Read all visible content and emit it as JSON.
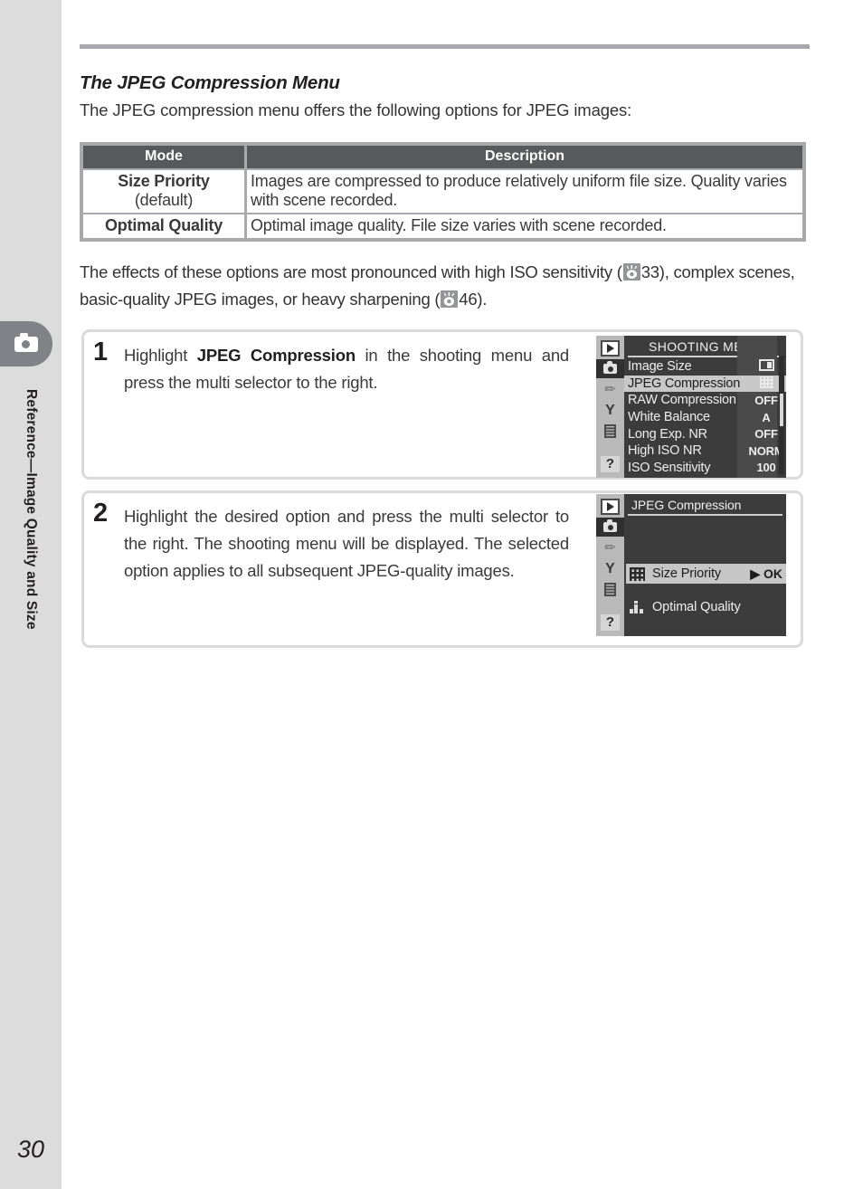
{
  "sidebar": {
    "tab_icon": "camera-icon",
    "chapter_title": "Reference—Image Quality and Size",
    "page_number": "30"
  },
  "section": {
    "heading": "The JPEG Compression Menu",
    "intro": "The JPEG compression menu offers the following options for JPEG images:"
  },
  "table": {
    "headers": [
      "Mode",
      "Description"
    ],
    "rows": [
      {
        "mode": "Size Priority",
        "mode_sub": "(default)",
        "description": "Images are compressed to produce relatively uniform file size.  Quality varies with scene recorded."
      },
      {
        "mode": "Optimal Quality",
        "mode_sub": "",
        "description": "Optimal image quality.  File size varies with scene recorded."
      }
    ]
  },
  "effects": {
    "part1": "The effects of these options are most pronounced with high ISO sensitivity (",
    "ref1": "33),",
    "part2": " complex scenes, basic-quality JPEG images, or heavy sharpening (",
    "ref2": "46).",
    "ref_icon": "reference-eye-icon"
  },
  "steps": [
    {
      "number": "1",
      "text_before": "Highlight ",
      "text_bold": "JPEG Compression",
      "text_after": " in the shooting menu and press the multi selector to the right."
    },
    {
      "number": "2",
      "text_before": "",
      "text_bold": "",
      "text_after": "Highlight the desired option and press the multi selector to the right.  The shooting menu will be displayed.  The selected option applies to all subsequent JPEG-quality images."
    }
  ],
  "lcd1": {
    "title": "SHOOTING MENU",
    "rail": [
      {
        "icon": "playback-icon",
        "active": false
      },
      {
        "icon": "shooting-camera-icon",
        "active": true
      },
      {
        "icon": "pencil-custom-icon",
        "active": false
      },
      {
        "icon": "wrench-setup-icon",
        "active": false
      },
      {
        "icon": "recent-settings-icon",
        "active": false
      },
      {
        "icon": "help-question-icon",
        "active": false
      }
    ],
    "rows": [
      {
        "label": "Image Size",
        "value": "",
        "value_icon": "image-size-icon",
        "selected": false
      },
      {
        "label": "JPEG Compression",
        "value": "",
        "value_icon": "compression-grid-icon",
        "selected": true
      },
      {
        "label": "RAW Compression",
        "value": "OFF",
        "value_icon": "",
        "selected": false
      },
      {
        "label": "White Balance",
        "value": "A",
        "value_icon": "",
        "selected": false
      },
      {
        "label": "Long Exp. NR",
        "value": "OFF",
        "value_icon": "",
        "selected": false
      },
      {
        "label": "High ISO NR",
        "value": "NORM",
        "value_icon": "",
        "selected": false
      },
      {
        "label": "ISO Sensitivity",
        "value": "100",
        "value_icon": "",
        "selected": false
      }
    ]
  },
  "lcd2": {
    "title": "JPEG Compression",
    "options": [
      {
        "label": "Size Priority",
        "icon": "size-priority-grid-icon",
        "ok_label": "▶ OK",
        "selected": true
      },
      {
        "label": "Optimal Quality",
        "icon": "optimal-quality-steps-icon",
        "ok_label": "",
        "selected": false
      }
    ]
  },
  "colors": {
    "sidebar_gray": "#dcdcdc",
    "tab_gray": "#808287",
    "rule_gray": "#a7a9ac",
    "table_header": "#58595b",
    "lcd_bg": "#3c3c3c",
    "lcd_highlight": "#c8c8c8"
  }
}
